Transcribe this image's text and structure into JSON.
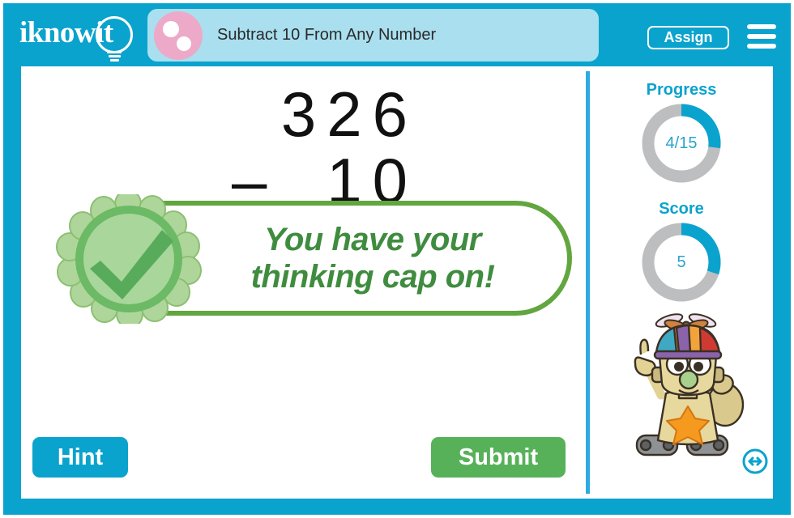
{
  "app": {
    "brand": "iknowit",
    "brand_icon": "lightbulb-icon"
  },
  "header": {
    "lesson_icon": "pink-circle-two-dots-icon",
    "lesson_title": "Subtract 10 From Any Number",
    "assign_label": "Assign",
    "menu_icon": "hamburger-menu-icon",
    "bar_color": "#0aa3cd",
    "pill_color": "#a9dfee",
    "pill_icon_color": "#eda9c8"
  },
  "problem": {
    "minuend": "326",
    "operator": "–",
    "subtrahend": "10"
  },
  "feedback": {
    "badge_icon": "green-checkmark-badge-icon",
    "message": "You have your\nthinking cap on!",
    "text_color": "#3f8c3f",
    "border_color": "#62a63f"
  },
  "actions": {
    "hint_label": "Hint",
    "hint_color": "#0aa3cd",
    "submit_label": "Submit",
    "submit_color": "#57b159"
  },
  "sidebar": {
    "progress": {
      "label": "Progress",
      "value": "4/15",
      "current": 4,
      "total": 15,
      "percent": 27,
      "arc_color": "#0aa3cd",
      "track_color": "#bcbec0"
    },
    "score": {
      "label": "Score",
      "value": "5",
      "percent": 30,
      "arc_color": "#0aa3cd",
      "track_color": "#bcbec0"
    },
    "mascot_icon": "robot-mascot-propeller-hat-icon",
    "resize_icon": "resize-horizontal-arrow-icon"
  }
}
